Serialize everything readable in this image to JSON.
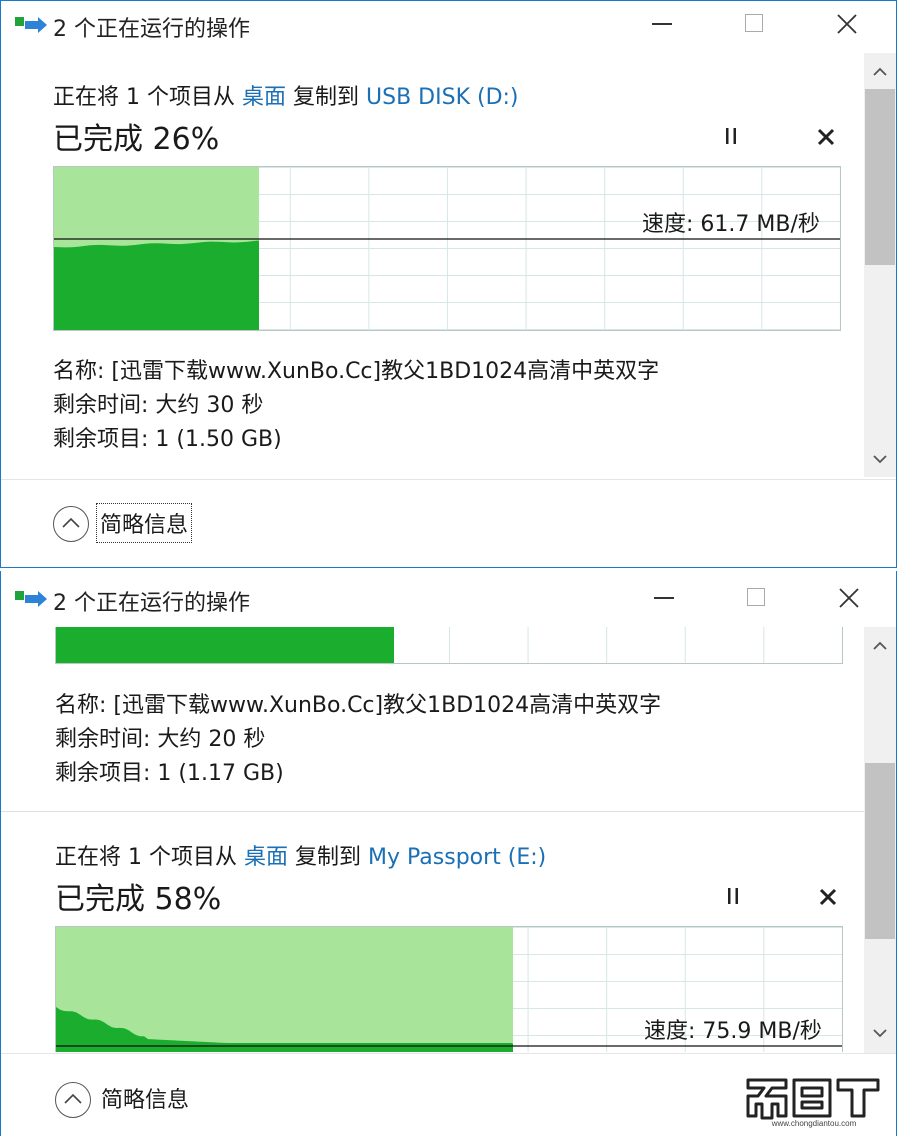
{
  "window1": {
    "title": "2 个正在运行的操作",
    "op": {
      "desc_prefix": "正在将 1 个项目从",
      "from": "桌面",
      "desc_mid": "复制到",
      "to": "USB DISK (D:)",
      "completed_label": "已完成 26%",
      "progress": 0.26,
      "speed_label": "速度: 61.7 MB/秒",
      "name_label": "名称:",
      "name_value": "[迅雷下载www.XunBo.Cc]教父1BD1024高清中英双字",
      "time_label": "剩余时间:",
      "time_value": "大约 30 秒",
      "items_label": "剩余项目:",
      "items_value": "1 (1.50 GB)"
    },
    "fewer_details": "简略信息"
  },
  "window2": {
    "title": "2 个正在运行的操作",
    "op_top": {
      "progress": 0.43,
      "name_label": "名称:",
      "name_value": "[迅雷下载www.XunBo.Cc]教父1BD1024高清中英双字",
      "time_label": "剩余时间:",
      "time_value": "大约 20 秒",
      "items_label": "剩余项目:",
      "items_value": "1 (1.17 GB)"
    },
    "op": {
      "desc_prefix": "正在将 1 个项目从",
      "from": "桌面",
      "desc_mid": "复制到",
      "to": "My Passport (E:)",
      "completed_label": "已完成 58%",
      "progress": 0.58,
      "speed_label": "速度: 75.9 MB/秒"
    },
    "fewer_details": "简略信息"
  },
  "icons": [
    "copy-transfer-icon",
    "minimize-icon",
    "maximize-icon",
    "close-icon",
    "pause-icon",
    "cancel-icon",
    "chevron-up-icon",
    "chevron-down-icon",
    "collapse-icon"
  ],
  "colors": {
    "accent": "#1979ca",
    "progress_fill": "#1aad2e",
    "progress_light": "#a8e49a",
    "link": "#1a6fb5"
  },
  "watermark": {
    "text": "充电头",
    "url": "www.chongdiantou.com"
  }
}
